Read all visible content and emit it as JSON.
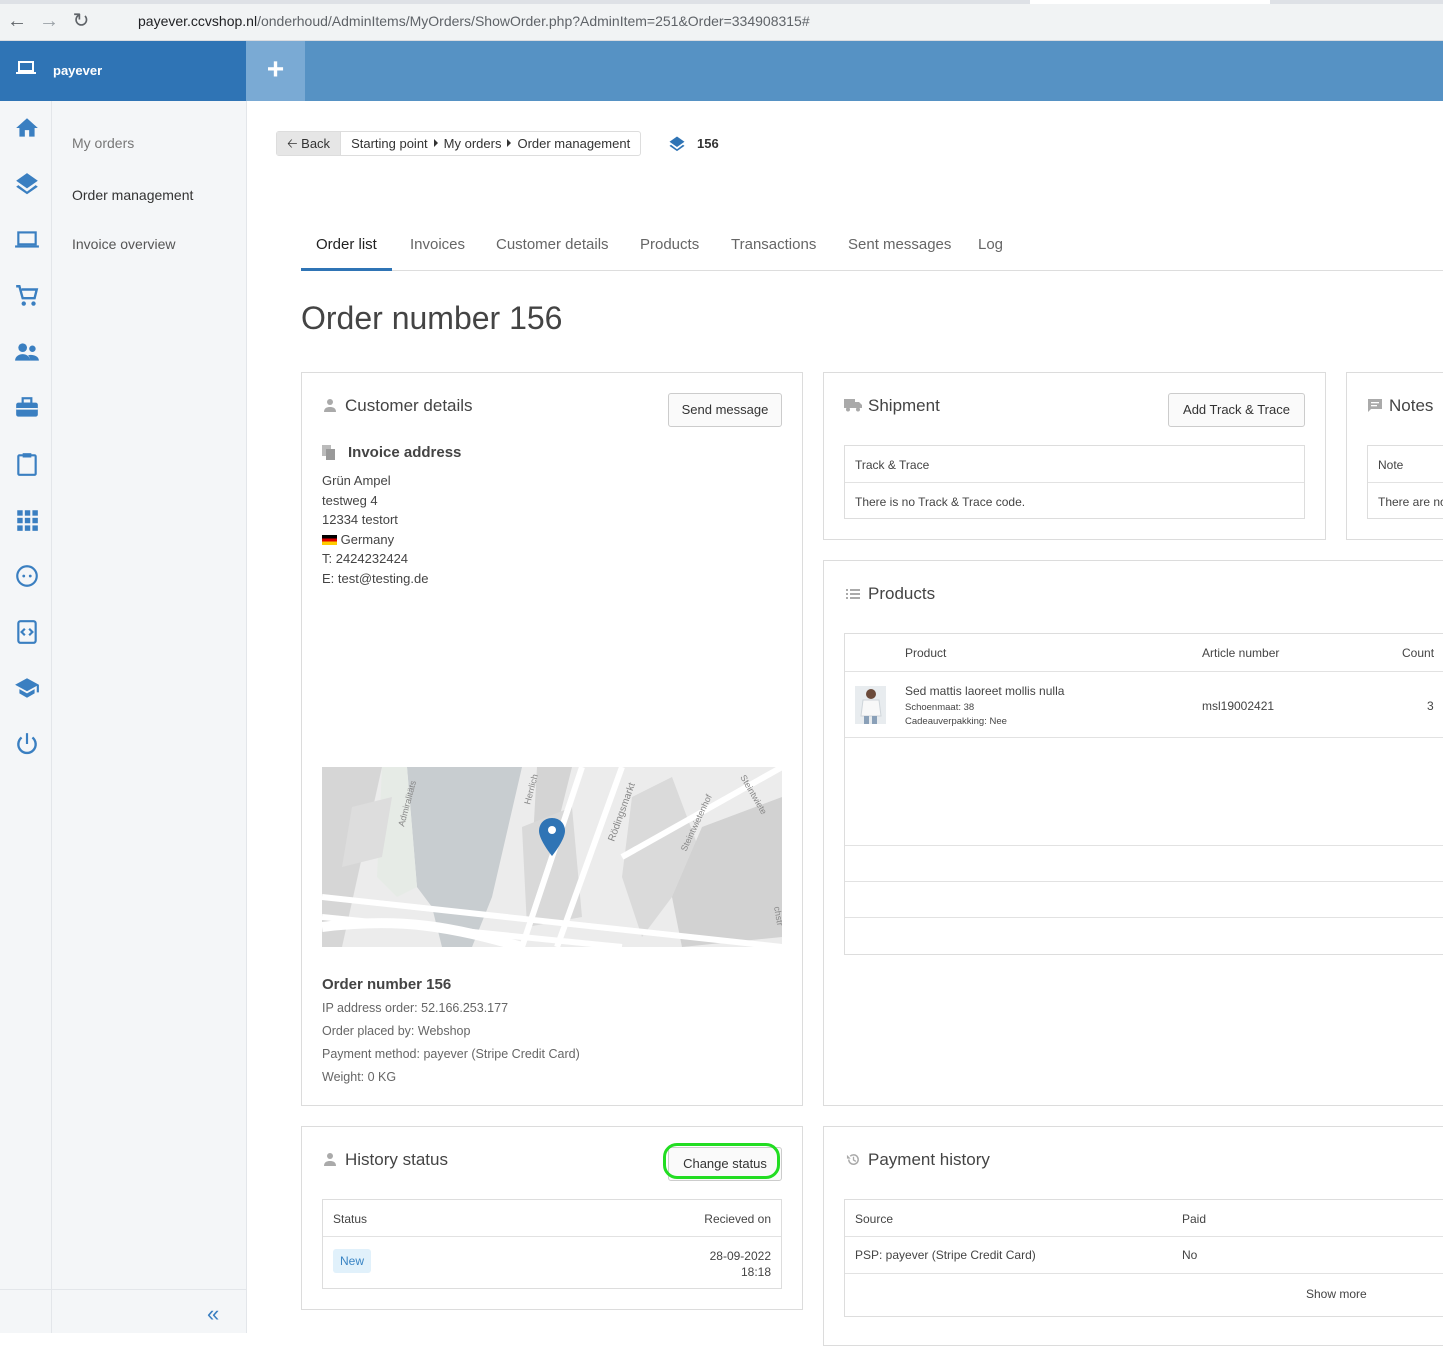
{
  "browser": {
    "url_domain": "payever.ccvshop.nl",
    "url_path": "/onderhoud/AdminItems/MyOrders/ShowOrder.php?AdminItem=251&Order=334908315#"
  },
  "app": {
    "brand": "payever",
    "plus_label": "+"
  },
  "rail_icons": [
    "home-icon",
    "layers-icon",
    "laptop-icon",
    "cart-icon",
    "users-icon",
    "briefcase-icon",
    "clipboard-icon",
    "apps-icon",
    "face-icon",
    "code-icon",
    "school-icon",
    "power-icon"
  ],
  "subnav": {
    "items": [
      "My orders",
      "Order management",
      "Invoice overview"
    ],
    "collapse": "«"
  },
  "breadcrumb": {
    "back": "Back",
    "items": [
      "Starting point",
      "My orders",
      "Order management"
    ],
    "order_no": "156"
  },
  "tabs": [
    "Order list",
    "Invoices",
    "Customer details",
    "Products",
    "Transactions",
    "Sent messages",
    "Log"
  ],
  "page_title": "Order number 156",
  "customer": {
    "title": "Customer details",
    "send_message": "Send message",
    "invoice_title": "Invoice address",
    "lines": [
      "Grün Ampel",
      "testweg 4",
      "12334 testort",
      "Germany",
      "T: 2424232424",
      "E: test@testing.de"
    ],
    "map_labels": [
      "Admiralitäts",
      "Herrlich",
      "Rödingsmarkt",
      "Steintwietenhof",
      "Steintwiete",
      "chstr"
    ],
    "order_title": "Order number 156",
    "order_lines": [
      "IP address order: 52.166.253.177",
      "Order placed by: Webshop",
      "Payment method: payever (Stripe Credit Card)",
      "Weight: 0 KG"
    ]
  },
  "shipment": {
    "title": "Shipment",
    "button": "Add Track & Trace",
    "col": "Track & Trace",
    "empty": "There is no Track & Trace code."
  },
  "notes": {
    "title": "Notes",
    "col": "Note",
    "empty": "There are no"
  },
  "products": {
    "title": "Products",
    "headers": [
      "Product",
      "Article number",
      "Count"
    ],
    "rows": [
      {
        "name": "Sed mattis laoreet mollis nulla",
        "opt1": "Schoenmaat: 38",
        "opt2": "Cadeauverpakking: Nee",
        "article": "msl19002421",
        "count": "3"
      }
    ]
  },
  "history": {
    "title": "History status",
    "button": "Change status",
    "headers": [
      "Status",
      "Recieved on"
    ],
    "status": "New",
    "date": "28-09-2022",
    "time": "18:18"
  },
  "payment": {
    "title": "Payment history",
    "headers": [
      "Source",
      "Paid"
    ],
    "source": "PSP: payever (Stripe Credit Card)",
    "paid": "No",
    "more": "Show more"
  }
}
